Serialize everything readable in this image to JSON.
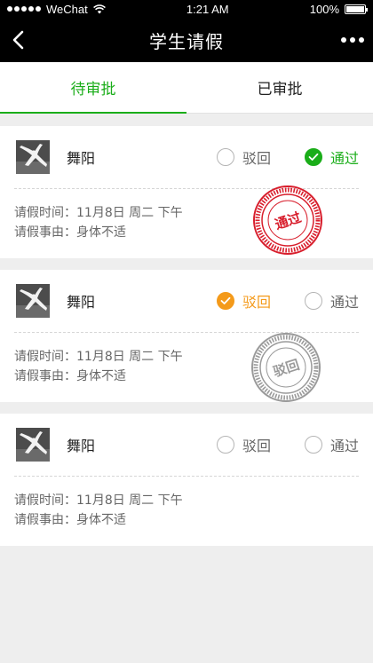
{
  "status_bar": {
    "carrier": "WeChat",
    "time": "1:21 AM",
    "battery": "100%"
  },
  "nav": {
    "title": "学生请假"
  },
  "tabs": [
    {
      "label": "待审批"
    },
    {
      "label": "已审批"
    }
  ],
  "options": {
    "reject": "驳回",
    "approve": "通过"
  },
  "requests": [
    {
      "name": "舞阳",
      "time_label": "请假时间：",
      "time_value": "11月8日 周二 下午",
      "reason_label": "请假事由：",
      "reason_value": "身体不适",
      "stamp_text": "通过",
      "stamp_color": "#d81e2c"
    },
    {
      "name": "舞阳",
      "time_label": "请假时间：",
      "time_value": "11月8日 周二 下午",
      "reason_label": "请假事由：",
      "reason_value": "身体不适",
      "stamp_text": "驳回",
      "stamp_color": "#9a9a9a"
    },
    {
      "name": "舞阳",
      "time_label": "请假时间：",
      "time_value": "11月8日 周二 下午",
      "reason_label": "请假事由：",
      "reason_value": "身体不适"
    }
  ],
  "colors": {
    "accent_green": "#1aad19",
    "accent_orange": "#f49a1a",
    "stamp_red": "#d81e2c",
    "stamp_gray": "#9a9a9a"
  }
}
